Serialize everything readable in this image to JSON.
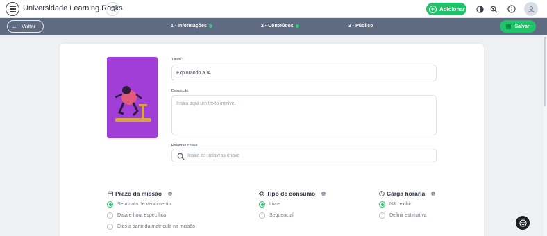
{
  "app": {
    "title": "Universidade Learning.Rocks"
  },
  "topbar": {
    "add_label": "Adicionar"
  },
  "stepsbar": {
    "back_label": "Voltar",
    "steps": [
      {
        "label": "1 · Informações",
        "done": true
      },
      {
        "label": "2 · Conteúdos",
        "done": true
      },
      {
        "label": "3 · Público",
        "done": false
      }
    ],
    "save_label": "Salvar"
  },
  "form": {
    "title_label": "Título *",
    "title_value": "Explorando a IA",
    "description_label": "Descrição",
    "description_placeholder": "Insira aqui um texto incrível",
    "keywords_label": "Palavras chave",
    "keywords_placeholder": "Insira as palavras chave"
  },
  "deadline": {
    "title": "Prazo da missão",
    "options": [
      "Sem data de vencimento",
      "Data e hora específica",
      "Dias a partir da matrícula na missão"
    ],
    "selected": 0
  },
  "consumption": {
    "title": "Tipo de consumo",
    "options": [
      "Livre",
      "Sequencial"
    ],
    "selected": 0
  },
  "workload": {
    "title": "Carga horária",
    "options": [
      "Não exibir",
      "Definir estimativa"
    ],
    "selected": 0
  },
  "colors": {
    "accent": "#20c26a",
    "stepsbar": "#5f6b80",
    "cover": "#a13ed7"
  }
}
